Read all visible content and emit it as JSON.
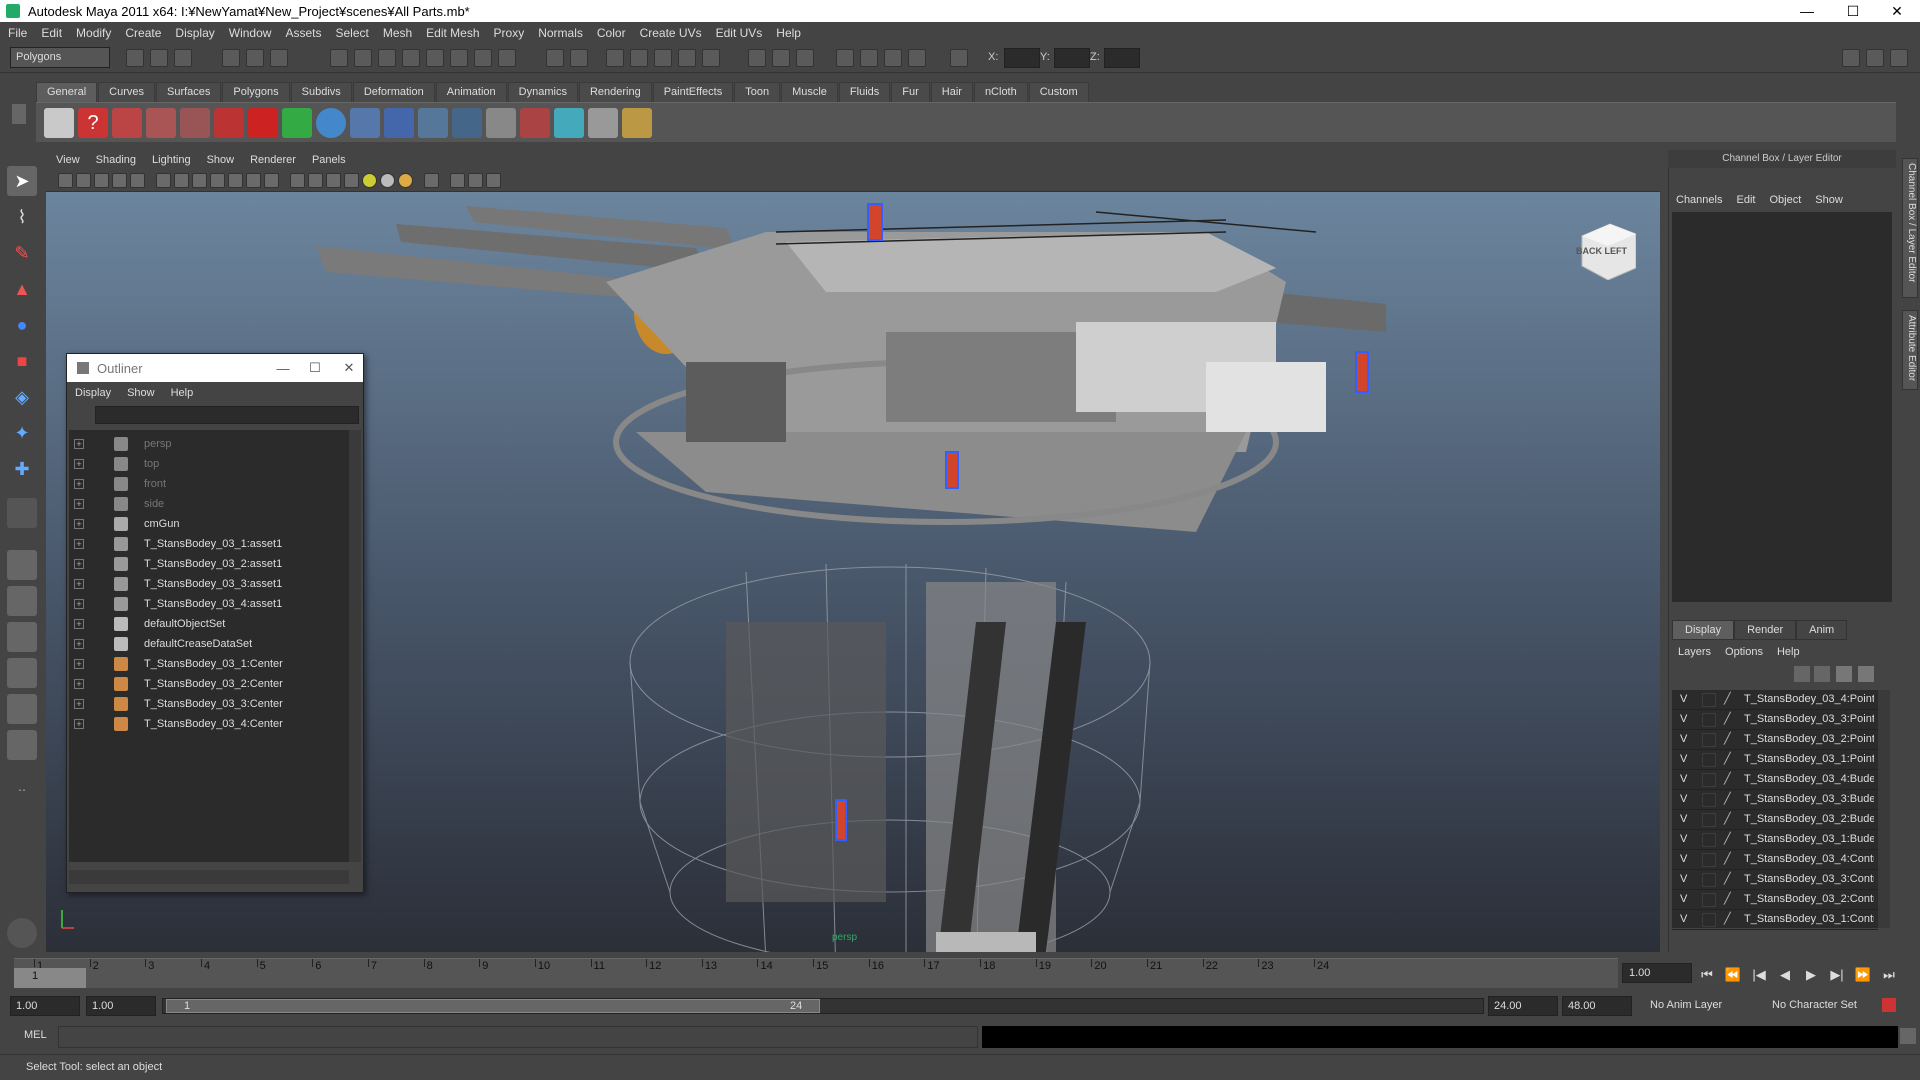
{
  "window": {
    "title": "Autodesk Maya 2011 x64: I:¥NewYamat¥New_Project¥scenes¥All Parts.mb*",
    "minimize": "—",
    "maximize": "☐",
    "close": "✕"
  },
  "menubar": [
    "File",
    "Edit",
    "Modify",
    "Create",
    "Display",
    "Window",
    "Assets",
    "Select",
    "Mesh",
    "Edit Mesh",
    "Proxy",
    "Normals",
    "Color",
    "Create UVs",
    "Edit UVs",
    "Help"
  ],
  "statusline": {
    "mode": "Polygons",
    "x_label": "X:",
    "y_label": "Y:",
    "z_label": "Z:"
  },
  "shelf": {
    "tabs": [
      "General",
      "Curves",
      "Surfaces",
      "Polygons",
      "Subdivs",
      "Deformation",
      "Animation",
      "Dynamics",
      "Rendering",
      "PaintEffects",
      "Toon",
      "Muscle",
      "Fluids",
      "Fur",
      "Hair",
      "nCloth",
      "Custom"
    ],
    "active_tab": "General",
    "icons": [
      "cog-icon",
      "help-icon",
      "render-icon",
      "render-region-icon",
      "ipr-icon",
      "magnet-icon",
      "arrow-icon",
      "sphere-icon",
      "joint-icon",
      "ik-icon",
      "bone-icon",
      "bone2-icon",
      "graph-icon",
      "paint-icon",
      "light-icon",
      "cube-icon",
      "brush-icon"
    ]
  },
  "viewport": {
    "menu": [
      "View",
      "Shading",
      "Lighting",
      "Show",
      "Renderer",
      "Panels"
    ],
    "camera": "persp",
    "viewcube": "BACK  LEFT"
  },
  "outliner": {
    "title": "Outliner",
    "menu": [
      "Display",
      "Show",
      "Help"
    ],
    "items": [
      {
        "name": "persp",
        "type": "camera",
        "dim": true
      },
      {
        "name": "top",
        "type": "camera",
        "dim": true
      },
      {
        "name": "front",
        "type": "camera",
        "dim": true
      },
      {
        "name": "side",
        "type": "camera",
        "dim": true
      },
      {
        "name": "cmGun",
        "type": "mesh",
        "dim": false
      },
      {
        "name": "T_StansBodey_03_1:asset1",
        "type": "asset",
        "dim": false
      },
      {
        "name": "T_StansBodey_03_2:asset1",
        "type": "asset",
        "dim": false
      },
      {
        "name": "T_StansBodey_03_3:asset1",
        "type": "asset",
        "dim": false
      },
      {
        "name": "T_StansBodey_03_4:asset1",
        "type": "asset",
        "dim": false
      },
      {
        "name": "defaultObjectSet",
        "type": "set",
        "dim": false
      },
      {
        "name": "defaultCreaseDataSet",
        "type": "set",
        "dim": false
      },
      {
        "name": "T_StansBodey_03_1:Center",
        "type": "joint",
        "dim": false
      },
      {
        "name": "T_StansBodey_03_2:Center",
        "type": "joint",
        "dim": false
      },
      {
        "name": "T_StansBodey_03_3:Center",
        "type": "joint",
        "dim": false
      },
      {
        "name": "T_StansBodey_03_4:Center",
        "type": "joint",
        "dim": false
      }
    ]
  },
  "channelbox": {
    "title": "Channel Box / Layer Editor",
    "menu": [
      "Channels",
      "Edit",
      "Object",
      "Show"
    ]
  },
  "layers": {
    "tabs": [
      "Display",
      "Render",
      "Anim"
    ],
    "active_tab": "Display",
    "menu": [
      "Layers",
      "Options",
      "Help"
    ],
    "rows": [
      {
        "v": "V",
        "name": "T_StansBodey_03_4:Point"
      },
      {
        "v": "V",
        "name": "T_StansBodey_03_3:Point"
      },
      {
        "v": "V",
        "name": "T_StansBodey_03_2:Point"
      },
      {
        "v": "V",
        "name": "T_StansBodey_03_1:Point"
      },
      {
        "v": "V",
        "name": "T_StansBodey_03_4:Bude"
      },
      {
        "v": "V",
        "name": "T_StansBodey_03_3:Bude"
      },
      {
        "v": "V",
        "name": "T_StansBodey_03_2:Bude"
      },
      {
        "v": "V",
        "name": "T_StansBodey_03_1:Bude"
      },
      {
        "v": "V",
        "name": "T_StansBodey_03_4:Contr"
      },
      {
        "v": "V",
        "name": "T_StansBodey_03_3:Contr"
      },
      {
        "v": "V",
        "name": "T_StansBodey_03_2:Contr"
      },
      {
        "v": "V",
        "name": "T_StansBodey_03_1:Contr"
      }
    ]
  },
  "sidebar_tabs": [
    "Channel Box / Layer Editor",
    "Attribute Editor"
  ],
  "timeslider": {
    "ticks": [
      "1",
      "2",
      "3",
      "4",
      "5",
      "6",
      "7",
      "8",
      "9",
      "10",
      "11",
      "12",
      "13",
      "14",
      "15",
      "16",
      "17",
      "18",
      "19",
      "20",
      "21",
      "22",
      "23",
      "24"
    ],
    "current": "1",
    "current_field": "1.00"
  },
  "playback": [
    "⏮",
    "⏪",
    "|◀",
    "◀",
    "▶",
    "▶|",
    "⏩",
    "⏭"
  ],
  "range": {
    "start_time": "1.00",
    "playback_start": "1.00",
    "slider_start": "1",
    "slider_end": "24",
    "playback_end": "24.00",
    "end_time": "48.00",
    "anim_layer": "No Anim Layer",
    "char_set": "No Character Set"
  },
  "cmdline": {
    "label": "MEL"
  },
  "helpline": {
    "text": "Select Tool: select an object"
  }
}
